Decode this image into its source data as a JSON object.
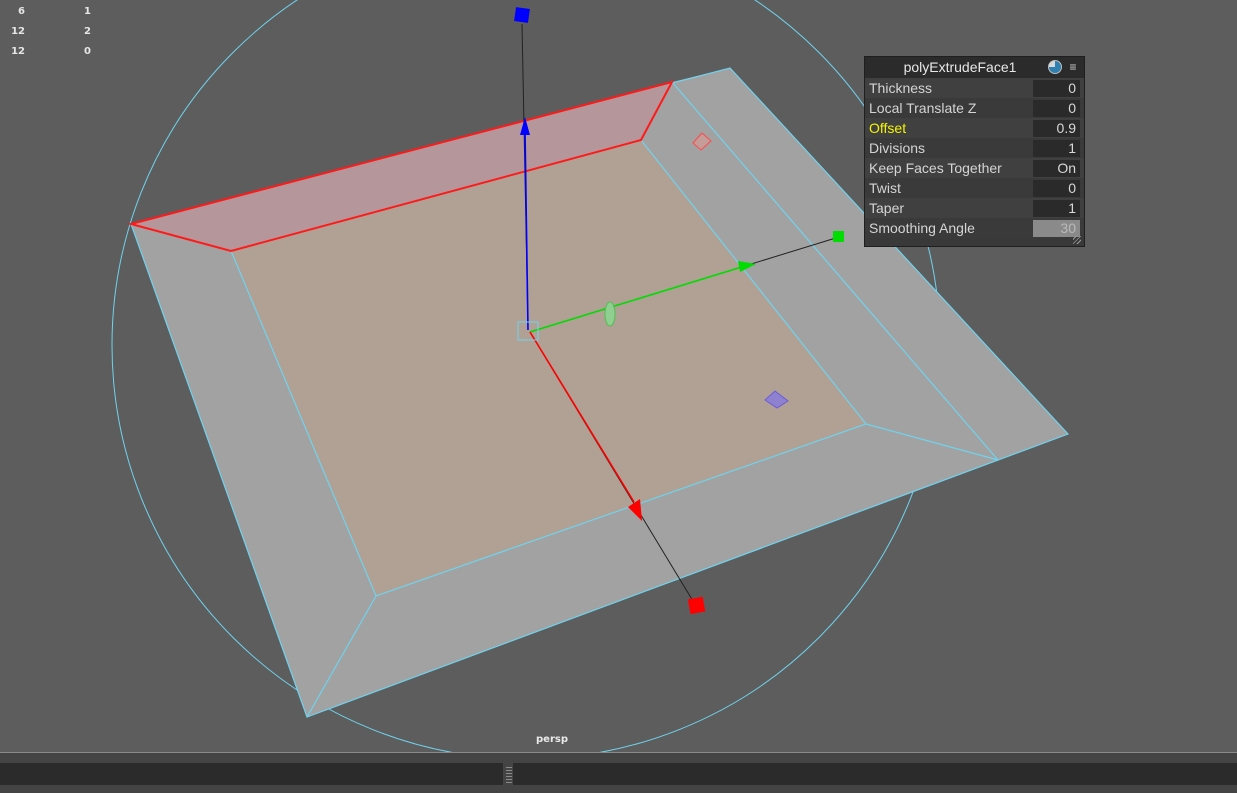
{
  "hud": {
    "rows": [
      {
        "a": "6",
        "b": "1"
      },
      {
        "a": "12",
        "b": "2"
      },
      {
        "a": "12",
        "b": "0"
      }
    ]
  },
  "viewport": {
    "camera_label": "persp"
  },
  "panel": {
    "title": "polyExtrudeFace1",
    "pie_icon": "pie-chart-icon",
    "menu_icon": "hamburger-menu-icon",
    "rows": [
      {
        "label": "Thickness",
        "value": "0"
      },
      {
        "label": "Local Translate Z",
        "value": "0"
      },
      {
        "label": "Offset",
        "value": "0.9"
      },
      {
        "label": "Divisions",
        "value": "1"
      },
      {
        "label": "Keep Faces Together",
        "value": "On"
      },
      {
        "label": "Twist",
        "value": "0"
      },
      {
        "label": "Taper",
        "value": "1"
      },
      {
        "label": "Smoothing Angle",
        "value": "30"
      }
    ],
    "highlight_color": "#f5f500"
  },
  "colors": {
    "background": "#5d5d5d",
    "wire": "#6fd3ee",
    "selected_edge": "#ff1a1a",
    "axis_x": "#ff0000",
    "axis_y": "#00dd00",
    "axis_z": "#0000ff"
  }
}
